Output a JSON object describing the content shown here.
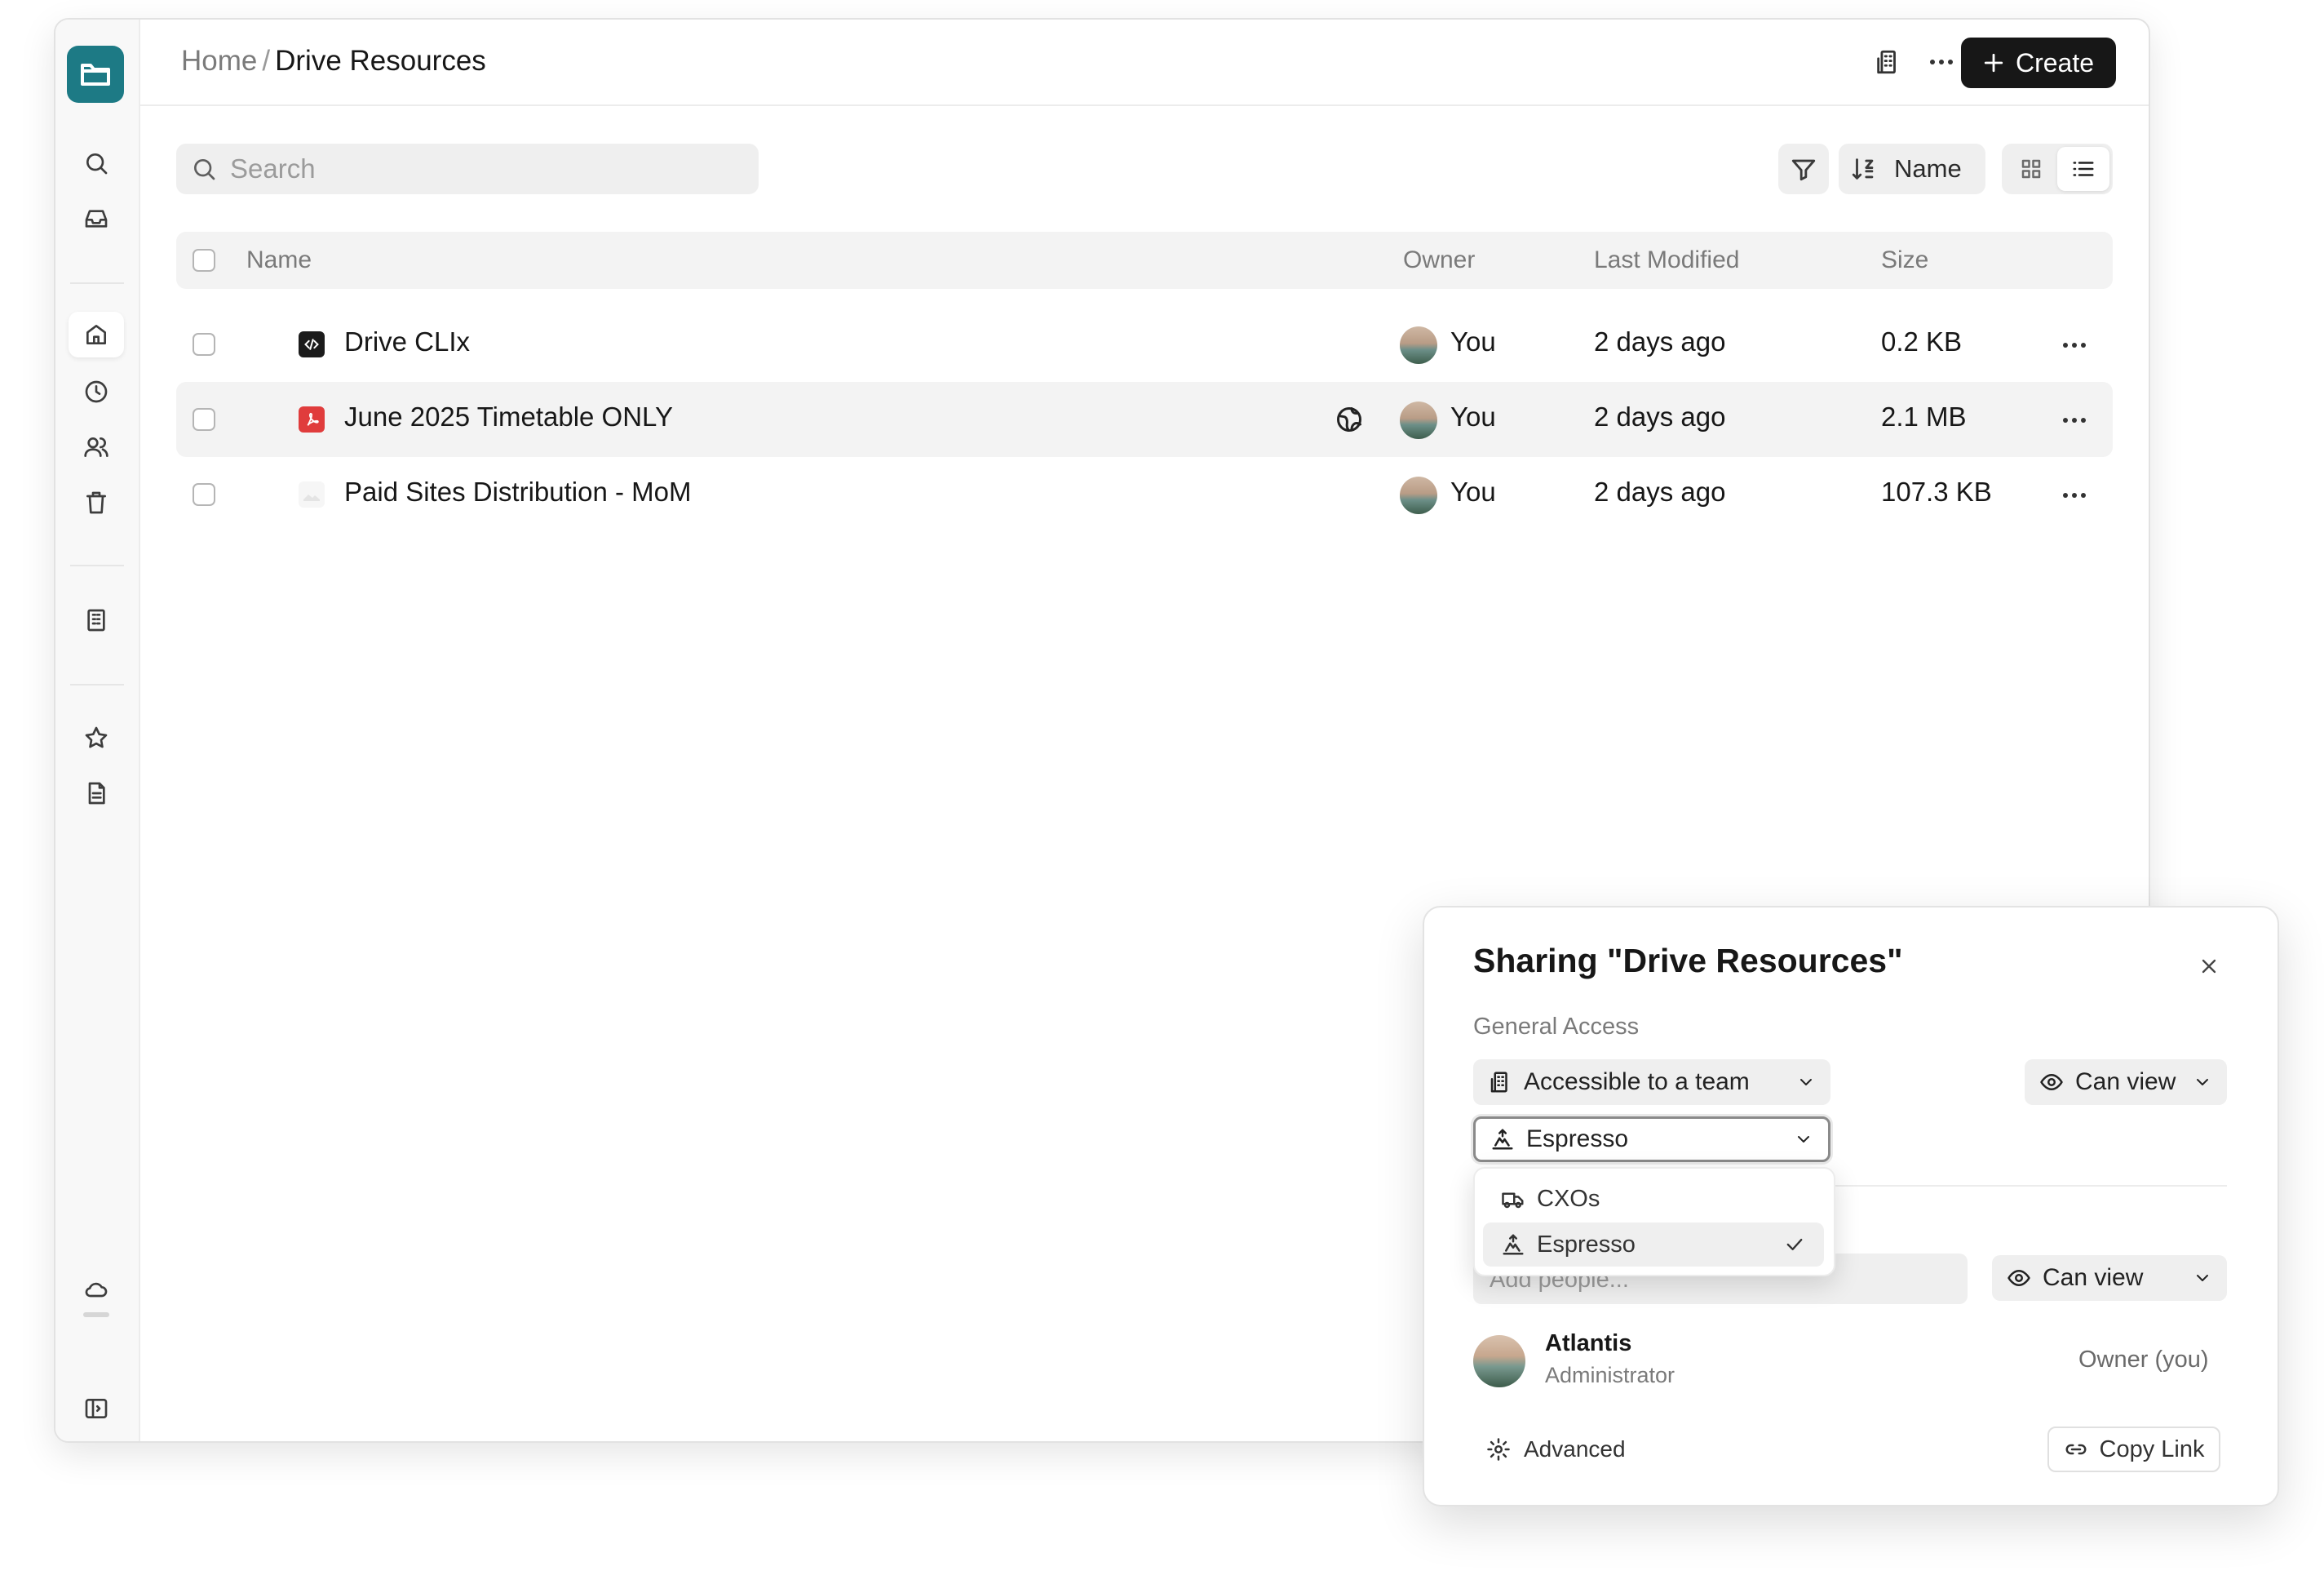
{
  "app": {
    "name": "Drive"
  },
  "breadcrumb": {
    "home": "Home",
    "separator": "/",
    "current": "Drive Resources"
  },
  "toolbar": {
    "create_label": "Create",
    "search_placeholder": "Search",
    "sort_label": "Name"
  },
  "table": {
    "columns": {
      "name": "Name",
      "owner": "Owner",
      "modified": "Last Modified",
      "size": "Size"
    },
    "rows": [
      {
        "name": "Drive CLIx",
        "owner": "You",
        "modified": "2 days ago",
        "size": "0.2 KB",
        "icon": "code-file-icon",
        "shared": false
      },
      {
        "name": "June 2025 Timetable ONLY",
        "owner": "You",
        "modified": "2 days ago",
        "size": "2.1 MB",
        "icon": "pdf-file-icon",
        "shared": true
      },
      {
        "name": "Paid Sites Distribution - MoM",
        "owner": "You",
        "modified": "2 days ago",
        "size": "107.3 KB",
        "icon": "image-file-icon",
        "shared": false
      }
    ]
  },
  "share_dialog": {
    "title": "Sharing \"Drive Resources\"",
    "general_access_label": "General Access",
    "access_option": "Accessible to a team",
    "access_permission": "Can view",
    "team_selected": "Espresso",
    "team_options": [
      {
        "label": "CXOs",
        "selected": false
      },
      {
        "label": "Espresso",
        "selected": true
      }
    ],
    "add_people_placeholder": "Add people...",
    "add_people_permission": "Can view",
    "user": {
      "name": "Atlantis",
      "role": "Administrator",
      "status": "Owner (you)"
    },
    "advanced_label": "Advanced",
    "copy_link_label": "Copy Link"
  },
  "colors": {
    "brand": "#1d7a85",
    "primary_button": "#171717",
    "pdf_red": "#e03c3c"
  }
}
